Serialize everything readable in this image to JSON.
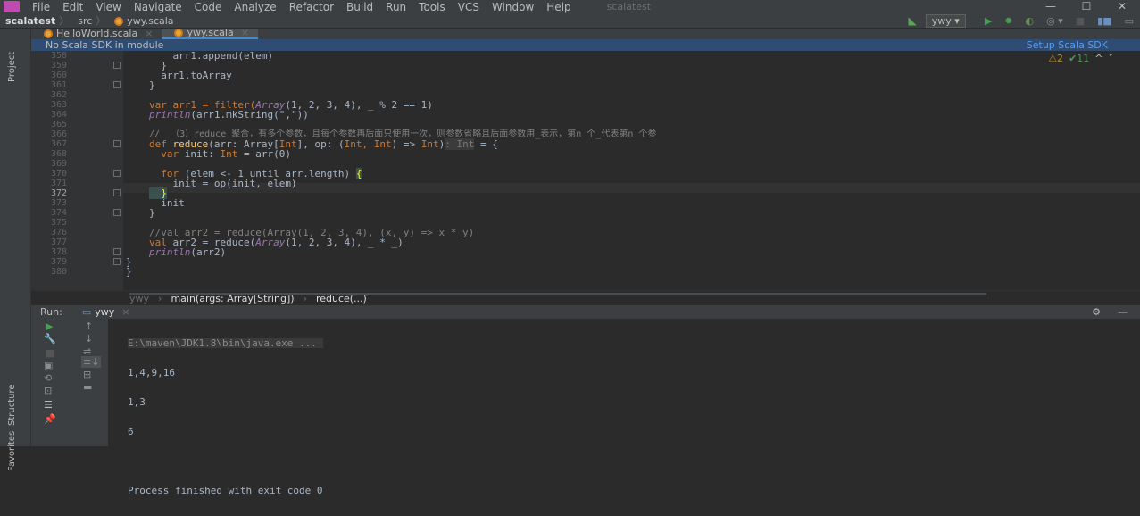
{
  "app": {
    "title": "scalatest"
  },
  "menu": [
    "File",
    "Edit",
    "View",
    "Navigate",
    "Code",
    "Analyze",
    "Refactor",
    "Build",
    "Run",
    "Tools",
    "VCS",
    "Window",
    "Help"
  ],
  "window_controls": {
    "minimize": "—",
    "maximize": "☐",
    "close": "✕"
  },
  "breadcrumb": {
    "project": "scalatest",
    "folder": "src",
    "file": "ywy.scala"
  },
  "toolbar": {
    "run_config": "ywy ▾"
  },
  "tabs": [
    {
      "label": "HelloWorld.scala",
      "close": "×"
    },
    {
      "label": "ywy.scala",
      "close": "×"
    }
  ],
  "notice": {
    "message": "No Scala SDK in module",
    "action": "Setup Scala SDK"
  },
  "inspections": {
    "warnings": "⚠2",
    "checks": "✔11",
    "up": "^",
    "down": "˅"
  },
  "side_labels": {
    "project": "Project",
    "structure": "Structure",
    "favorites": "Favorites"
  },
  "line_numbers": [
    "358",
    "359",
    "360",
    "361",
    "362",
    "363",
    "364",
    "365",
    "366",
    "367",
    "368",
    "369",
    "370",
    "371",
    "372",
    "373",
    "374",
    "375",
    "376",
    "377",
    "378",
    "379",
    "380"
  ],
  "code_lines": {
    "l358": "    arr1.append(elem)",
    "l359": "  }",
    "l360": "  arr1.toArray",
    "l361": "}",
    "l363a": "var arr1 = filter(",
    "l363b": "Array",
    "l363c": "(1, 2, 3, 4), _ % 2 == 1)",
    "l364a": "println",
    "l364b": "(arr1.mkString(\",\"))",
    "l366": "//  （3）reduce 聚合，有多个参数，且每个参数再后面只使用一次，则参数省略且后面参数用_表示，第n 个_代表第n 个参",
    "l367a": "def ",
    "l367b": "reduce",
    "l367c": "(arr: Array[",
    "l367d": "Int",
    "l367e": "], op: (",
    "l367f": "Int, Int",
    "l367g": ") => ",
    "l367h": "Int",
    "l367i": ")",
    "l367j": ": Int",
    "l367k": " = {",
    "l368a": "  var ",
    "l368b": "init",
    "l368c": ": ",
    "l368d": "Int",
    "l368e": " = arr(0)",
    "l370a": "  for ",
    "l370b": "(elem <- 1 until arr.length) ",
    "l370c": "{",
    "l371": "    init = op(init, elem)",
    "l372": "  }",
    "l373": "  init",
    "l374": "}",
    "l376": "//val arr2 = reduce(Array(1, 2, 3, 4), (x, y) => x * y)",
    "l377a": "val ",
    "l377b": "arr2 = reduce(",
    "l377c": "Array",
    "l377d": "(1, 2, 3, 4), _ * _)",
    "l378a": "println",
    "l378b": "(arr2)",
    "l379": "}",
    "l380": "}"
  },
  "code_breadcrumb": {
    "obj": "ywy",
    "method": "main(args: Array[String])",
    "fn": "reduce(...)"
  },
  "run_panel": {
    "label": "Run:",
    "config": "ywy",
    "close": "×",
    "gear": "⚙",
    "minimize": "—"
  },
  "console_lines": [
    "E:\\maven\\JDK1.8\\bin\\java.exe ...",
    "1,4,9,16",
    "1,3",
    "6",
    "",
    "Process finished with exit code 0"
  ],
  "colors": {
    "keyword": "#cc7832",
    "number": "#6897bb",
    "string": "#6a8759",
    "comment": "#808080",
    "function": "#ffc66d",
    "accent": "#4a88c7"
  }
}
